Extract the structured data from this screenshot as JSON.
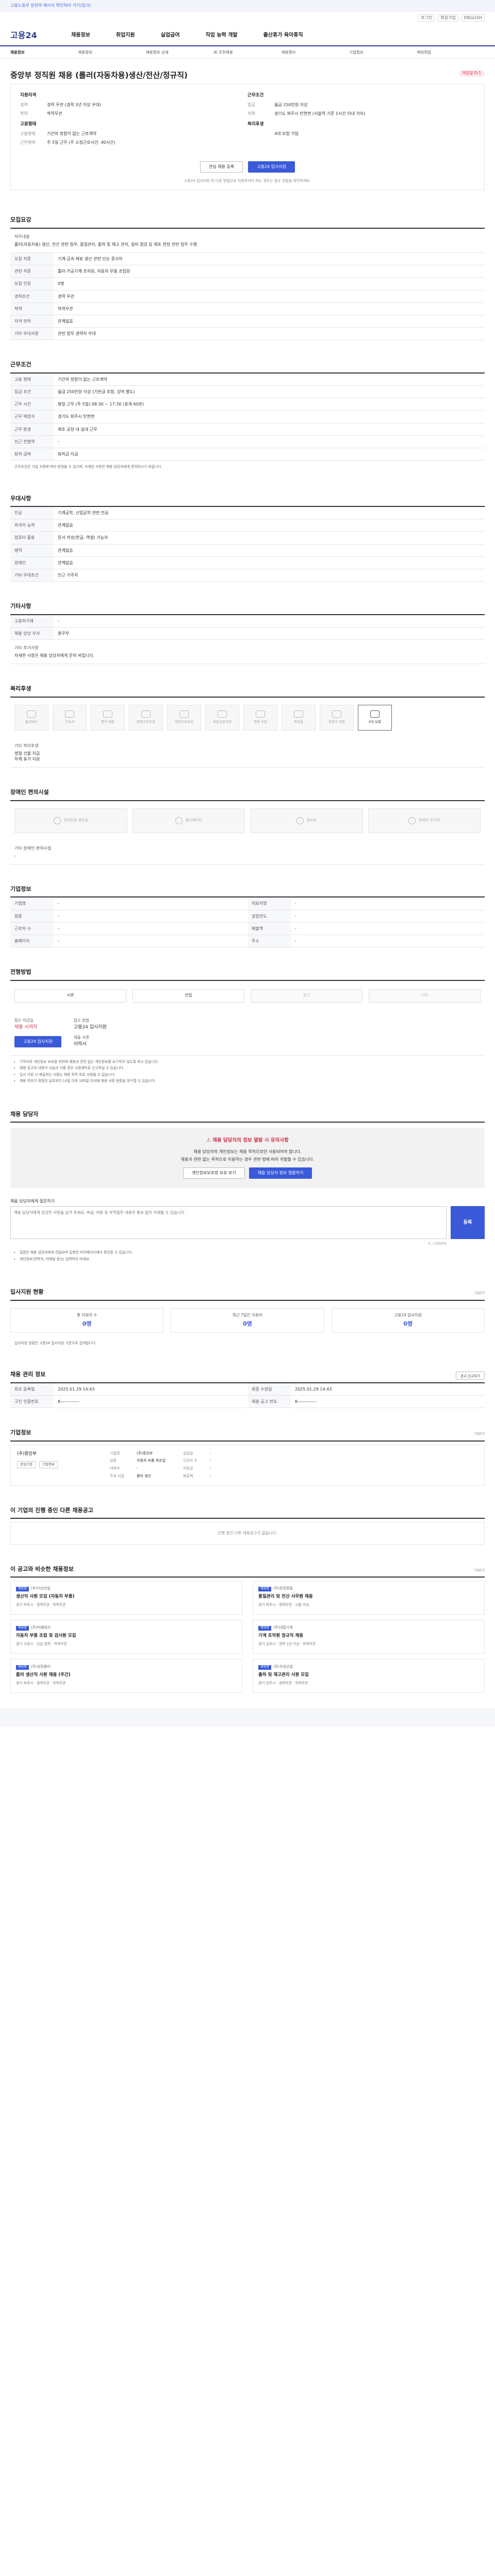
{
  "top_banner": "고용노동부 장관의 메시지 확인하러 가기(링크)",
  "util": [
    "로그인",
    "회원가입",
    "ENGLISH"
  ],
  "logo": "고용24",
  "gnb": [
    "채용정보",
    "취업지원",
    "실업급여",
    "직업 능력 개발",
    "출산휴가 육아휴직"
  ],
  "subnav": [
    "채용정보",
    "채용정보",
    "채용정보 상세",
    "AI 추천채용",
    "채용행사",
    "기업정보",
    "해외취업"
  ],
  "title": "중앙부 정직원 채용 (롤러(자동차용)생산/전산/정규직)",
  "title_tag": "마감일 D-1",
  "summary": {
    "left_head": "지원자격",
    "left": [
      {
        "k": "경력",
        "v": "경력 무관 (경력 3년 이상 우대)"
      },
      {
        "k": "학력",
        "v": "학력무관"
      }
    ],
    "left_head2": "고용형태",
    "left2": [
      {
        "k": "고용형태",
        "v": "기간의 정함이 없는 근로계약"
      },
      {
        "k": "근무형태",
        "v": "주 5일 근무 (주 소정근로시간: 40시간)"
      }
    ],
    "right_head": "근무조건",
    "right": [
      {
        "k": "임금",
        "v": "월급 250만원 이상"
      },
      {
        "k": "지역",
        "v": "경기도 파주시 탄현면 (서울역 기준 1시간 이내 거리)"
      }
    ],
    "right_head2": "복리후생",
    "right2": [
      {
        "k": "",
        "v": "4대 보험 가입"
      }
    ],
    "btn_interest": "관심 채용 등록",
    "btn_apply": "고용24 입사지원",
    "note": "고용24 입사지원 외 다른 방법으로 지원하셔야 하는 경우는 접수 방법을 확인하세요."
  },
  "recruit": {
    "heading": "모집요강",
    "duty_label": "직무내용",
    "duty": "롤러(자동차용) 생산, 전산 관련 업무, 품질관리, 출하 및 재고 관리, 설비 점검 등 제조 현장 전반 업무 수행",
    "rows": [
      {
        "k": "모집 직종",
        "v": "기계·금속·재료 생산 관련 단순 종사자"
      },
      {
        "k": "관련 직종",
        "v": "롤러·가공기계 조작원, 자동차 부품 조립원"
      },
      {
        "k": "모집 인원",
        "v": "0명"
      },
      {
        "k": "경력조건",
        "v": "경력 무관"
      },
      {
        "k": "학력",
        "v": "학력무관"
      },
      {
        "k": "자격 면허",
        "v": "관계없음"
      },
      {
        "k": "기타 우대사항",
        "v": "관련 업무 경력자 우대"
      }
    ]
  },
  "work": {
    "heading": "근무조건",
    "rows": [
      {
        "k": "고용 형태",
        "v": "기간의 정함이 없는 근로계약"
      },
      {
        "k": "임금 조건",
        "v": "월급 250만원 이상 (기본급 포함, 상여 별도)"
      },
      {
        "k": "근무 시간",
        "v": "평일 근무 (주 5일) 08:30 ~ 17:30 (휴게 60분)"
      },
      {
        "k": "근무 예정지",
        "v": "경기도 파주시 탄현면"
      },
      {
        "k": "근무 환경",
        "v": "제조 공장 내 실내 근무"
      },
      {
        "k": "인근 전철역",
        "v": "-"
      },
      {
        "k": "퇴직 급여",
        "v": "퇴직금 지급"
      }
    ],
    "note": "근무조건은 기업 사정에 따라 변경될 수 있으며, 자세한 사항은 채용 담당자에게 문의하시기 바랍니다."
  },
  "qualify": {
    "heading": "우대사항",
    "rows": [
      {
        "k": "전공",
        "v": "기계공학, 산업공학 관련 전공"
      },
      {
        "k": "외국어 능력",
        "v": "관계없음"
      },
      {
        "k": "컴퓨터 활용",
        "v": "문서 작성(한글, 엑셀) 가능자"
      },
      {
        "k": "병역",
        "v": "관계없음"
      },
      {
        "k": "장애인",
        "v": "관계없음"
      },
      {
        "k": "기타 우대조건",
        "v": "인근 거주자"
      }
    ]
  },
  "other": {
    "heading": "기타사항",
    "rows": [
      {
        "k": "고용허가제",
        "v": "-"
      },
      {
        "k": "채용 담당 부서",
        "v": "총무부"
      }
    ],
    "box_label": "기타 추가사항",
    "box": "자세한 사항은 채용 담당자에게 문의 바랍니다."
  },
  "welfare": {
    "heading": "복리후생",
    "items": [
      {
        "label": "통근버스",
        "on": false
      },
      {
        "label": "기숙사",
        "on": false
      },
      {
        "label": "중식 제공",
        "on": false
      },
      {
        "label": "연장근로수당",
        "on": false
      },
      {
        "label": "야간근로수당",
        "on": false
      },
      {
        "label": "휴일근로수당",
        "on": false
      },
      {
        "label": "연차 수당",
        "on": false
      },
      {
        "label": "퇴직금",
        "on": false
      },
      {
        "label": "경조사 지원",
        "on": false
      },
      {
        "label": "4대 보험",
        "on": true
      }
    ],
    "extra_label": "기타 복리후생",
    "extra": [
      "명절 선물 지급",
      "하계 휴가 지원"
    ]
  },
  "disability": {
    "heading": "장애인 편의시설",
    "items": [
      "장애인용 화장실",
      "엘리베이터",
      "경사로",
      "장애인 주차장"
    ],
    "extra_label": "기타 장애인 편의시설",
    "extra": "-"
  },
  "company_info": {
    "heading": "기업정보",
    "rows": [
      {
        "k": "기업명",
        "v": "-",
        "k2": "대표자명",
        "v2": "-"
      },
      {
        "k": "업종",
        "v": "-",
        "k2": "설립연도",
        "v2": "-"
      },
      {
        "k": "근로자 수",
        "v": "-",
        "k2": "매출액",
        "v2": "-"
      },
      {
        "k": "홈페이지",
        "v": "-",
        "k2": "주소",
        "v2": "-"
      }
    ]
  },
  "process": {
    "heading": "전형방법",
    "steps": [
      "서류",
      "면접",
      "필기",
      "기타"
    ],
    "steps_off": [
      false,
      false,
      true,
      true
    ],
    "apply_label": "접수 마감일",
    "apply_value": "채용 시까지",
    "method_label": "접수 방법",
    "method_value": "고용24 입사지원",
    "doc_label": "제출 서류",
    "doc_value": "이력서",
    "apply_btn": "고용24 입사지원",
    "notes": [
      "구직자의 개인정보 보호를 위하여 채용과 관련 없는 개인정보를 요구하지 않도록 하고 있습니다.",
      "채용 공고의 내용이 사실과 다를 경우 고용센터로 신고하실 수 있습니다.",
      "입사 지원 시 제출하는 서류는 채용 목적 외로 사용될 수 없습니다.",
      "채용 여부가 확정된 날로부터 14일 이후 180일 이내에 채용 서류 반환을 청구할 수 있습니다."
    ]
  },
  "contact": {
    "heading": "채용 담당자",
    "alert": "채용 담당자의 정보 열람 시 유의사항",
    "line1": "채용 담당자의 개인정보는 채용 목적으로만 사용되어야 합니다.",
    "line2": "채용과 관련 없는 목적으로 이용하는 경우 관련 법에 따라 처벌될 수 있습니다.",
    "btn_view": "개인정보보호법 보호 보기",
    "btn_contact": "채용 담당자 정보 열람하기"
  },
  "inquiry": {
    "label": "채용 담당자에게 질문하기",
    "placeholder": "채용 담당자에게 궁금한 사항을 남겨 주세요. 욕설, 비방 등 부적절한 내용은 통보 없이 삭제될 수 있습니다.",
    "counter": "0 / 1000자",
    "send": "등록",
    "notes": [
      "질문은 채용 담당자에게 전달되며 답변은 마이페이지에서 확인할 수 있습니다.",
      "개인정보(연락처, 이메일 등)는 입력하지 마세요."
    ]
  },
  "stats": {
    "heading": "입사지원 현황",
    "more": "더보기",
    "items": [
      {
        "label": "총 지원자 수",
        "n": "0명"
      },
      {
        "label": "최근 7일간 지원자",
        "n": "0명"
      },
      {
        "label": "고용24 입사지원",
        "n": "0명"
      }
    ],
    "note": "입사지원 현황은 고용24 입사지원 기준으로 집계됩니다."
  },
  "meta": {
    "heading": "채용 관리 정보",
    "rows": [
      {
        "k": "최초 등록일",
        "v": "2025.01.29 14:43",
        "k2": "최종 수정일",
        "v2": "2025.01.29 14:43"
      },
      {
        "k": "구인 인증번호",
        "v": "K-------------",
        "k2": "채용 공고 번호",
        "v2": "K-------------"
      }
    ],
    "btn": "공고 신고하기"
  },
  "company": {
    "heading": "기업정보",
    "more": "더보기",
    "name": "(주)중앙부",
    "b1": "관심기업",
    "b2": "기업정보",
    "grid": [
      {
        "k": "기업명",
        "v": "(주)중앙부"
      },
      {
        "k": "설립일",
        "v": "-"
      },
      {
        "k": "업종",
        "v": "자동차 부품 제조업"
      },
      {
        "k": "근로자 수",
        "v": "-"
      },
      {
        "k": "대표자",
        "v": "-"
      },
      {
        "k": "자본금",
        "v": "-"
      },
      {
        "k": "주요 사업",
        "v": "롤러 생산"
      },
      {
        "k": "매출액",
        "v": "-"
      }
    ]
  },
  "related": {
    "heading": "이 기업의 진행 중인 다른 채용공고",
    "empty": "진행 중인 다른 채용공고가 없습니다."
  },
  "recommend": {
    "heading": "이 공고와 비슷한 채용정보",
    "more": "더보기",
    "jobs": [
      {
        "tag": "채용중",
        "co": "(주)다산산업",
        "title": "생산직 사원 모집 (자동차 부품)",
        "meta": "경기 파주시 · 경력무관 · 학력무관"
      },
      {
        "tag": "채용중",
        "co": "(주)한성정밀",
        "title": "품질관리 및 전산 사무원 채용",
        "meta": "경기 파주시 · 경력무관 · 고졸 이상"
      },
      {
        "tag": "채용중",
        "co": "(주)미래테크",
        "title": "자동차 부품 조립 및 검사원 모집",
        "meta": "경기 고양시 · 신입·경력 · 학력무관"
      },
      {
        "tag": "채용중",
        "co": "(주)대흥기계",
        "title": "기계 조작원 정규직 채용",
        "meta": "경기 김포시 · 경력 1년 이상 · 학력무관"
      },
      {
        "tag": "채용중",
        "co": "(주)성진롤러",
        "title": "롤러 생산직 사원 채용 (주간)",
        "meta": "경기 파주시 · 경력무관 · 학력무관"
      },
      {
        "tag": "채용중",
        "co": "(주)우성산업",
        "title": "출하 및 재고관리 사원 모집",
        "meta": "경기 양주시 · 경력무관 · 학력무관"
      }
    ]
  }
}
